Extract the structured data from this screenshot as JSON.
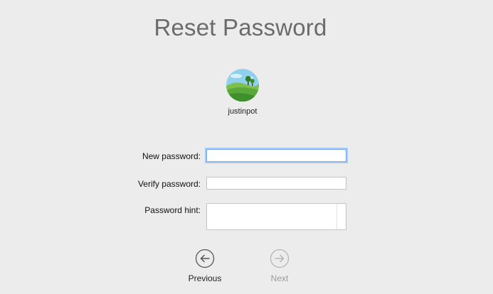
{
  "header": {
    "title": "Reset Password"
  },
  "user": {
    "username": "justinpot",
    "avatar_icon": "landscape-icon"
  },
  "form": {
    "new_password_label": "New password:",
    "new_password_value": "",
    "verify_password_label": "Verify password:",
    "verify_password_value": "",
    "hint_label": "Password hint:",
    "hint_value": ""
  },
  "navigation": {
    "previous_label": "Previous",
    "previous_icon": "arrow-left-circle-icon",
    "next_label": "Next",
    "next_icon": "arrow-right-circle-icon",
    "next_enabled": false
  },
  "colors": {
    "background": "#ececec",
    "focus_ring": "#a9c9f3",
    "title": "#6b6b6b"
  }
}
